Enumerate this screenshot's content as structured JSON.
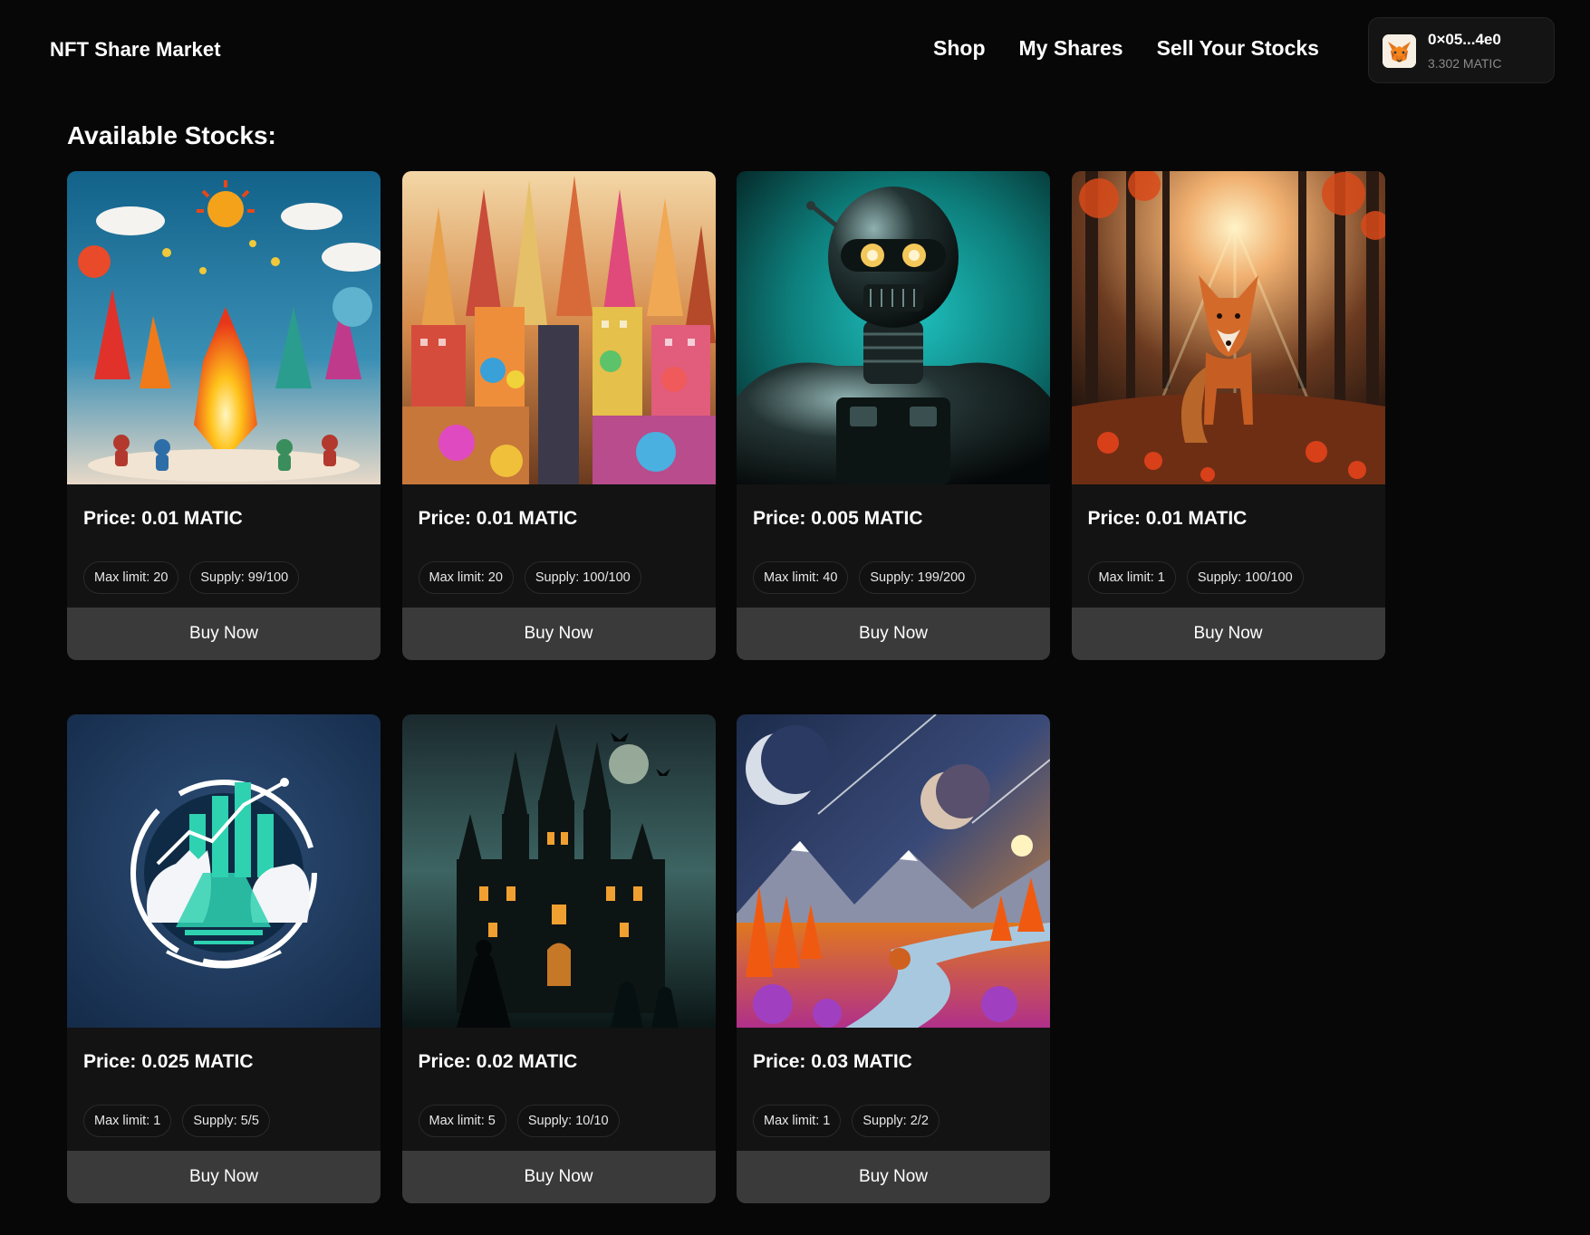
{
  "header": {
    "brand": "NFT Share Market",
    "nav": [
      {
        "label": "Shop"
      },
      {
        "label": "My Shares"
      },
      {
        "label": "Sell Your Stocks"
      }
    ],
    "wallet": {
      "address": "0×05...4e0",
      "balance": "3.302 MATIC",
      "icon": "metamask-fox-icon"
    }
  },
  "main": {
    "title": "Available Stocks:",
    "buy_label": "Buy Now",
    "stocks": [
      {
        "price": "Price: 0.01 MATIC",
        "max_limit": "Max limit: 20",
        "supply": "Supply: 99/100",
        "image": "colorful-bonfire-festival-art"
      },
      {
        "price": "Price: 0.01 MATIC",
        "max_limit": "Max limit: 20",
        "supply": "Supply: 100/100",
        "image": "candy-city-art"
      },
      {
        "price": "Price: 0.005 MATIC",
        "max_limit": "Max limit: 40",
        "supply": "Supply: 199/200",
        "image": "chrome-robot-art"
      },
      {
        "price": "Price: 0.01 MATIC",
        "max_limit": "Max limit: 1",
        "supply": "Supply: 100/100",
        "image": "fox-in-autumn-forest-art"
      },
      {
        "price": "Price: 0.025 MATIC",
        "max_limit": "Max limit: 1",
        "supply": "Supply: 5/5",
        "image": "bull-bear-market-logo-art"
      },
      {
        "price": "Price: 0.02 MATIC",
        "max_limit": "Max limit: 5",
        "supply": "Supply: 10/10",
        "image": "haunted-castle-art"
      },
      {
        "price": "Price: 0.03 MATIC",
        "max_limit": "Max limit: 1",
        "supply": "Supply: 2/2",
        "image": "alien-planet-landscape-art"
      }
    ]
  }
}
